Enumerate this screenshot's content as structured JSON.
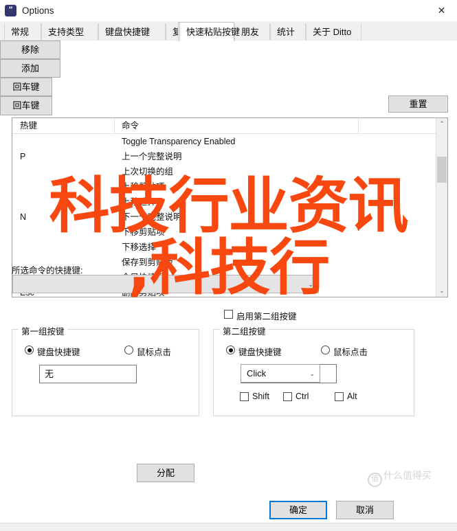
{
  "window": {
    "title": "Options",
    "icon": "quote-icon",
    "close_label": "✕"
  },
  "tabs": [
    {
      "label": "常规",
      "active": false
    },
    {
      "label": "支持类型",
      "active": false
    },
    {
      "label": "键盘快捷键",
      "active": false
    },
    {
      "label": "复制缓冲区",
      "active": false
    },
    {
      "label": "快速粘贴按键",
      "active": true
    },
    {
      "label": "朋友",
      "active": false
    },
    {
      "label": "统计",
      "active": false
    },
    {
      "label": "关于 Ditto",
      "active": false
    }
  ],
  "toolbar": {
    "reset_label": "重置"
  },
  "list": {
    "columns": [
      "热键",
      "命令"
    ],
    "rows": [
      {
        "key": "",
        "command": "Toggle Transparency Enabled"
      },
      {
        "key": "P",
        "command": "上一个完整说明"
      },
      {
        "key": "",
        "command": "上次切换的组"
      },
      {
        "key": "",
        "command": "上移剪贴项"
      },
      {
        "key": "",
        "command": "上移选择"
      },
      {
        "key": "N",
        "command": "下一个完整说明"
      },
      {
        "key": "",
        "command": "下移剪贴项"
      },
      {
        "key": "",
        "command": "下移选择"
      },
      {
        "key": "",
        "command": "保存到剪贴板"
      },
      {
        "key": "",
        "command": "全局快捷键"
      },
      {
        "key": "Esc",
        "command": "删除剪贴项"
      }
    ],
    "scrollbar": {
      "up_arrow": "⌃",
      "down_arrow": "⌄"
    }
  },
  "shortcut": {
    "label": "所选命令的快捷键:",
    "combo_value": "",
    "combo_arrow": "⌄",
    "remove_label": "移除",
    "add_label": "添加"
  },
  "second_set_checkbox": {
    "label": "启用第二组按键",
    "checked": false
  },
  "group1": {
    "title": "第一组按键",
    "radio_keyboard": "键盘快捷键",
    "radio_mouse": "鼠标点击",
    "selected": "keyboard",
    "input_value": "无",
    "enter_label": "回车键"
  },
  "group2": {
    "title": "第二组按键",
    "radio_keyboard": "键盘快捷键",
    "radio_mouse": "鼠标点击",
    "selected": "keyboard",
    "combo_value": "Click",
    "combo_arrow": "⌄",
    "enter_label": "回车键",
    "modifiers": [
      {
        "label": "Shift",
        "checked": false
      },
      {
        "label": "Ctrl",
        "checked": false
      },
      {
        "label": "Alt",
        "checked": false
      }
    ]
  },
  "footer": {
    "assign_label": "分配",
    "ok_label": "确定",
    "cancel_label": "取消"
  },
  "overlay": {
    "line1": "科技行业资讯",
    "line2": ",科技行",
    "color": "#f8480f"
  },
  "watermark": {
    "mark": "值",
    "text": "什么值得买"
  }
}
